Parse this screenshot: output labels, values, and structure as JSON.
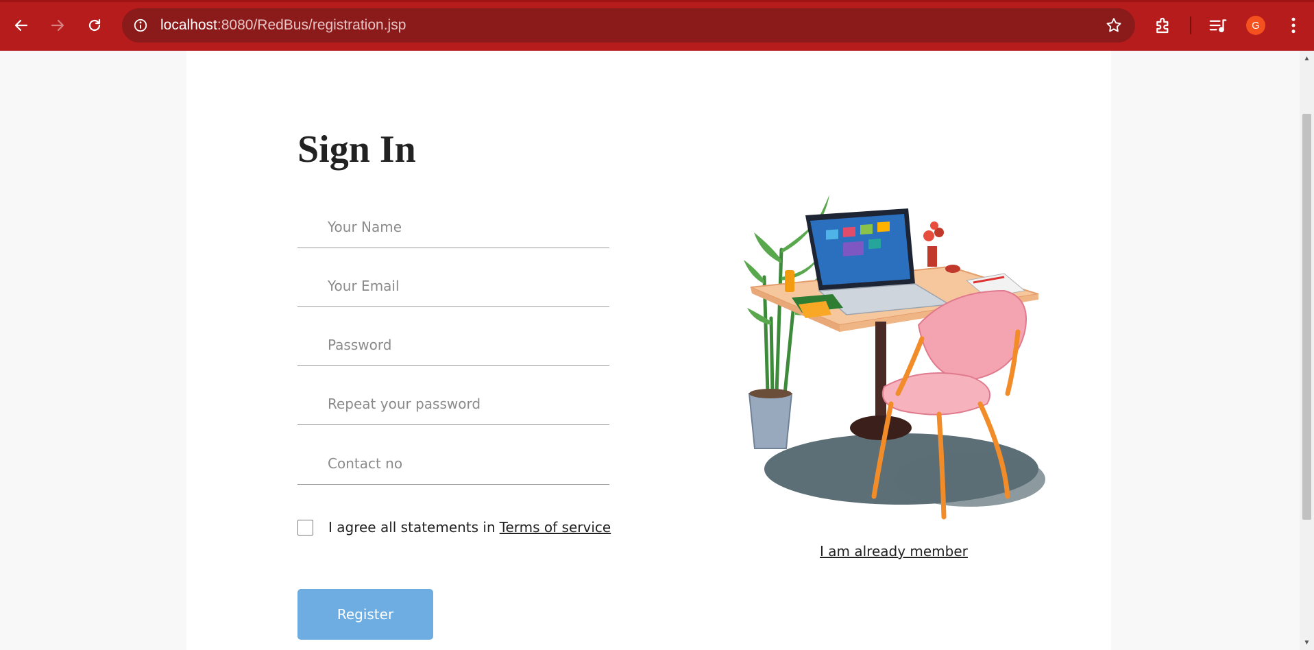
{
  "browser": {
    "url_host": "localhost",
    "url_rest": ":8080/RedBus/registration.jsp",
    "profile_initial": "G",
    "icons": {
      "back": "arrow-left-icon",
      "forward": "arrow-right-icon",
      "reload": "reload-icon",
      "info": "info-icon",
      "bookmark": "star-icon",
      "extensions": "puzzle-icon",
      "media": "media-queue-icon",
      "menu": "kebab-menu-icon"
    },
    "theme_color": "#b71c1c"
  },
  "form": {
    "title": "Sign In",
    "fields": {
      "name_placeholder": "Your Name",
      "email_placeholder": "Your Email",
      "password_placeholder": "Password",
      "repeat_password_placeholder": "Repeat your password",
      "contact_placeholder": "Contact no"
    },
    "agree_text": "I agree all statements in",
    "terms_link": "Terms of service",
    "register_label": "Register",
    "register_color": "#6dade2"
  },
  "side": {
    "illustration": "desk-with-laptop-chair-plant-illustration",
    "member_link": "I am already member"
  }
}
